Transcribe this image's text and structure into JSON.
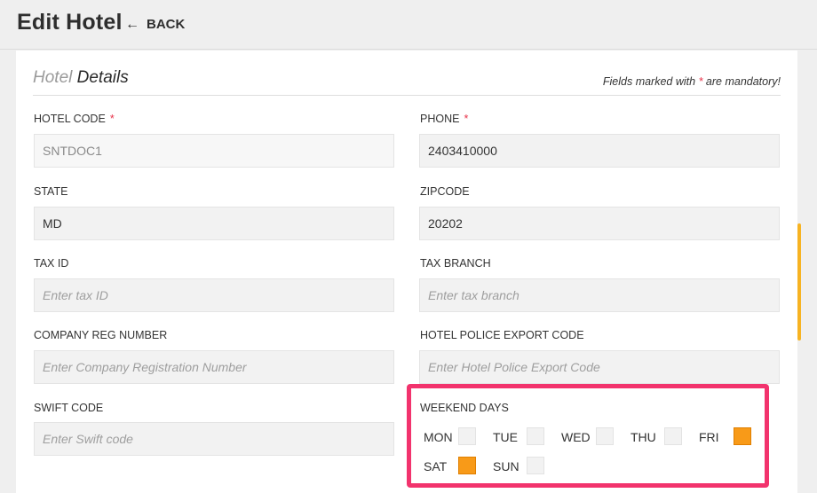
{
  "header": {
    "title": "Edit Hotel",
    "back_label": "BACK"
  },
  "section": {
    "title_light": "Hotel",
    "title_dark": "Details",
    "mandatory_prefix": "Fields marked with",
    "mandatory_star": "*",
    "mandatory_suffix": "are mandatory!"
  },
  "fields": {
    "hotel_code": {
      "label": "HOTEL CODE",
      "required": "*",
      "value": "SNTDOC1"
    },
    "phone": {
      "label": "PHONE",
      "required": "*",
      "value": "2403410000"
    },
    "state": {
      "label": "STATE",
      "value": "MD"
    },
    "zipcode": {
      "label": "ZIPCODE",
      "value": "20202"
    },
    "tax_id": {
      "label": "TAX ID",
      "placeholder": "Enter tax ID"
    },
    "tax_branch": {
      "label": "TAX BRANCH",
      "placeholder": "Enter tax branch"
    },
    "company_reg": {
      "label": "COMPANY REG NUMBER",
      "placeholder": "Enter Company Registration Number"
    },
    "police_export": {
      "label": "HOTEL POLICE EXPORT CODE",
      "placeholder": "Enter Hotel Police Export Code"
    },
    "swift": {
      "label": "SWIFT CODE",
      "placeholder": "Enter Swift code"
    }
  },
  "weekend": {
    "label": "WEEKEND DAYS",
    "days": [
      {
        "name": "MON",
        "checked": false
      },
      {
        "name": "TUE",
        "checked": false
      },
      {
        "name": "WED",
        "checked": false
      },
      {
        "name": "THU",
        "checked": false
      },
      {
        "name": "FRI",
        "checked": true
      },
      {
        "name": "SAT",
        "checked": true
      },
      {
        "name": "SUN",
        "checked": false
      }
    ]
  },
  "colors": {
    "accent": "#f89a18",
    "highlight_border": "#f2336d",
    "required_star": "#e8334a",
    "scrollbar": "#f7b322"
  }
}
